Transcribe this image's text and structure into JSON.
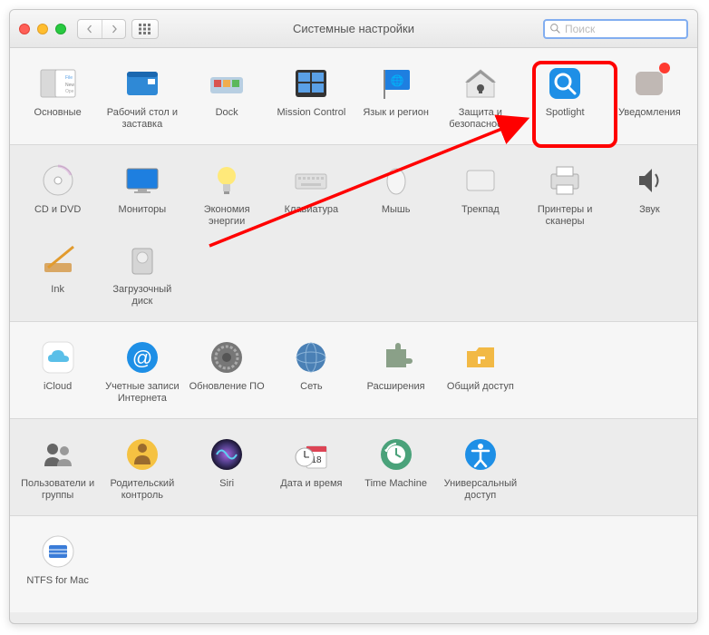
{
  "window": {
    "title": "Системные настройки"
  },
  "search": {
    "placeholder": "Поиск"
  },
  "row1": [
    {
      "name": "general",
      "label": "Основные"
    },
    {
      "name": "desktop",
      "label": "Рабочий стол и заставка"
    },
    {
      "name": "dock",
      "label": "Dock"
    },
    {
      "name": "mission",
      "label": "Mission Control"
    },
    {
      "name": "language",
      "label": "Язык и регион"
    },
    {
      "name": "security",
      "label": "Защита и безопасность"
    },
    {
      "name": "spotlight",
      "label": "Spotlight"
    },
    {
      "name": "notifications",
      "label": "Уведомления"
    }
  ],
  "row2": [
    {
      "name": "cddvd",
      "label": "CD и DVD"
    },
    {
      "name": "displays",
      "label": "Мониторы"
    },
    {
      "name": "energy",
      "label": "Экономия энергии"
    },
    {
      "name": "keyboard",
      "label": "Клавиатура"
    },
    {
      "name": "mouse",
      "label": "Мышь"
    },
    {
      "name": "trackpad",
      "label": "Трекпад"
    },
    {
      "name": "printers",
      "label": "Принтеры и сканеры"
    },
    {
      "name": "sound",
      "label": "Звук"
    }
  ],
  "row3": [
    {
      "name": "ink",
      "label": "Ink"
    },
    {
      "name": "startup",
      "label": "Загрузочный диск"
    }
  ],
  "row4": [
    {
      "name": "icloud",
      "label": "iCloud"
    },
    {
      "name": "accounts",
      "label": "Учетные записи Интернета"
    },
    {
      "name": "swupdate",
      "label": "Обновление ПО"
    },
    {
      "name": "network",
      "label": "Сеть"
    },
    {
      "name": "extensions",
      "label": "Расширения"
    },
    {
      "name": "sharing",
      "label": "Общий доступ"
    }
  ],
  "row5": [
    {
      "name": "users",
      "label": "Пользователи и группы"
    },
    {
      "name": "parental",
      "label": "Родительский контроль"
    },
    {
      "name": "siri",
      "label": "Siri"
    },
    {
      "name": "datetime",
      "label": "Дата и время"
    },
    {
      "name": "timemachine",
      "label": "Time Machine"
    },
    {
      "name": "accessibility",
      "label": "Универсальный доступ"
    }
  ],
  "row6": [
    {
      "name": "ntfs",
      "label": "NTFS for Mac"
    }
  ]
}
